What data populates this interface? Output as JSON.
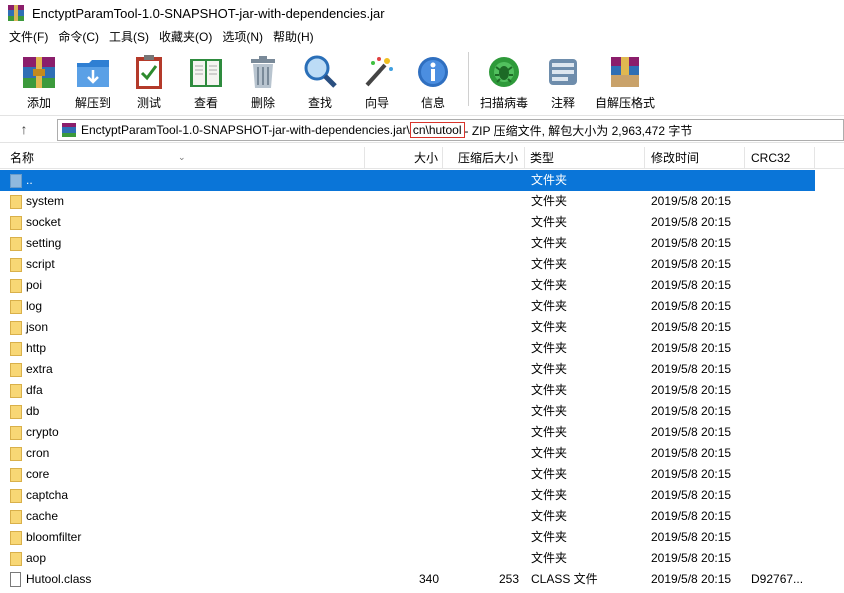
{
  "window": {
    "title": "EnctyptParamTool-1.0-SNAPSHOT-jar-with-dependencies.jar"
  },
  "menu": [
    "文件(F)",
    "命令(C)",
    "工具(S)",
    "收藏夹(O)",
    "选项(N)",
    "帮助(H)"
  ],
  "toolbar": {
    "add": "添加",
    "extract": "解压到",
    "test": "测试",
    "view": "查看",
    "delete": "删除",
    "find": "查找",
    "wizard": "向导",
    "info": "信息",
    "virus": "扫描病毒",
    "comment": "注释",
    "sfx": "自解压格式"
  },
  "address": {
    "prefix": "EnctyptParamTool-1.0-SNAPSHOT-jar-with-dependencies.jar\\",
    "highlight": "cn\\hutool",
    "suffix": " - ZIP 压缩文件, 解包大小为 2,963,472 字节"
  },
  "columns": {
    "name": "名称",
    "size": "大小",
    "packed": "压缩后大小",
    "type": "类型",
    "modified": "修改时间",
    "crc": "CRC32"
  },
  "files": [
    {
      "name": "..",
      "size": "",
      "packed": "",
      "type": "文件夹",
      "modified": "",
      "crc": ""
    },
    {
      "name": "system",
      "size": "",
      "packed": "",
      "type": "文件夹",
      "modified": "2019/5/8 20:15",
      "crc": ""
    },
    {
      "name": "socket",
      "size": "",
      "packed": "",
      "type": "文件夹",
      "modified": "2019/5/8 20:15",
      "crc": ""
    },
    {
      "name": "setting",
      "size": "",
      "packed": "",
      "type": "文件夹",
      "modified": "2019/5/8 20:15",
      "crc": ""
    },
    {
      "name": "script",
      "size": "",
      "packed": "",
      "type": "文件夹",
      "modified": "2019/5/8 20:15",
      "crc": ""
    },
    {
      "name": "poi",
      "size": "",
      "packed": "",
      "type": "文件夹",
      "modified": "2019/5/8 20:15",
      "crc": ""
    },
    {
      "name": "log",
      "size": "",
      "packed": "",
      "type": "文件夹",
      "modified": "2019/5/8 20:15",
      "crc": ""
    },
    {
      "name": "json",
      "size": "",
      "packed": "",
      "type": "文件夹",
      "modified": "2019/5/8 20:15",
      "crc": ""
    },
    {
      "name": "http",
      "size": "",
      "packed": "",
      "type": "文件夹",
      "modified": "2019/5/8 20:15",
      "crc": ""
    },
    {
      "name": "extra",
      "size": "",
      "packed": "",
      "type": "文件夹",
      "modified": "2019/5/8 20:15",
      "crc": ""
    },
    {
      "name": "dfa",
      "size": "",
      "packed": "",
      "type": "文件夹",
      "modified": "2019/5/8 20:15",
      "crc": ""
    },
    {
      "name": "db",
      "size": "",
      "packed": "",
      "type": "文件夹",
      "modified": "2019/5/8 20:15",
      "crc": ""
    },
    {
      "name": "crypto",
      "size": "",
      "packed": "",
      "type": "文件夹",
      "modified": "2019/5/8 20:15",
      "crc": ""
    },
    {
      "name": "cron",
      "size": "",
      "packed": "",
      "type": "文件夹",
      "modified": "2019/5/8 20:15",
      "crc": ""
    },
    {
      "name": "core",
      "size": "",
      "packed": "",
      "type": "文件夹",
      "modified": "2019/5/8 20:15",
      "crc": ""
    },
    {
      "name": "captcha",
      "size": "",
      "packed": "",
      "type": "文件夹",
      "modified": "2019/5/8 20:15",
      "crc": ""
    },
    {
      "name": "cache",
      "size": "",
      "packed": "",
      "type": "文件夹",
      "modified": "2019/5/8 20:15",
      "crc": ""
    },
    {
      "name": "bloomfilter",
      "size": "",
      "packed": "",
      "type": "文件夹",
      "modified": "2019/5/8 20:15",
      "crc": ""
    },
    {
      "name": "aop",
      "size": "",
      "packed": "",
      "type": "文件夹",
      "modified": "2019/5/8 20:15",
      "crc": ""
    },
    {
      "name": "Hutool.class",
      "size": "340",
      "packed": "253",
      "type": "CLASS 文件",
      "modified": "2019/5/8 20:15",
      "crc": "D92767..."
    }
  ]
}
